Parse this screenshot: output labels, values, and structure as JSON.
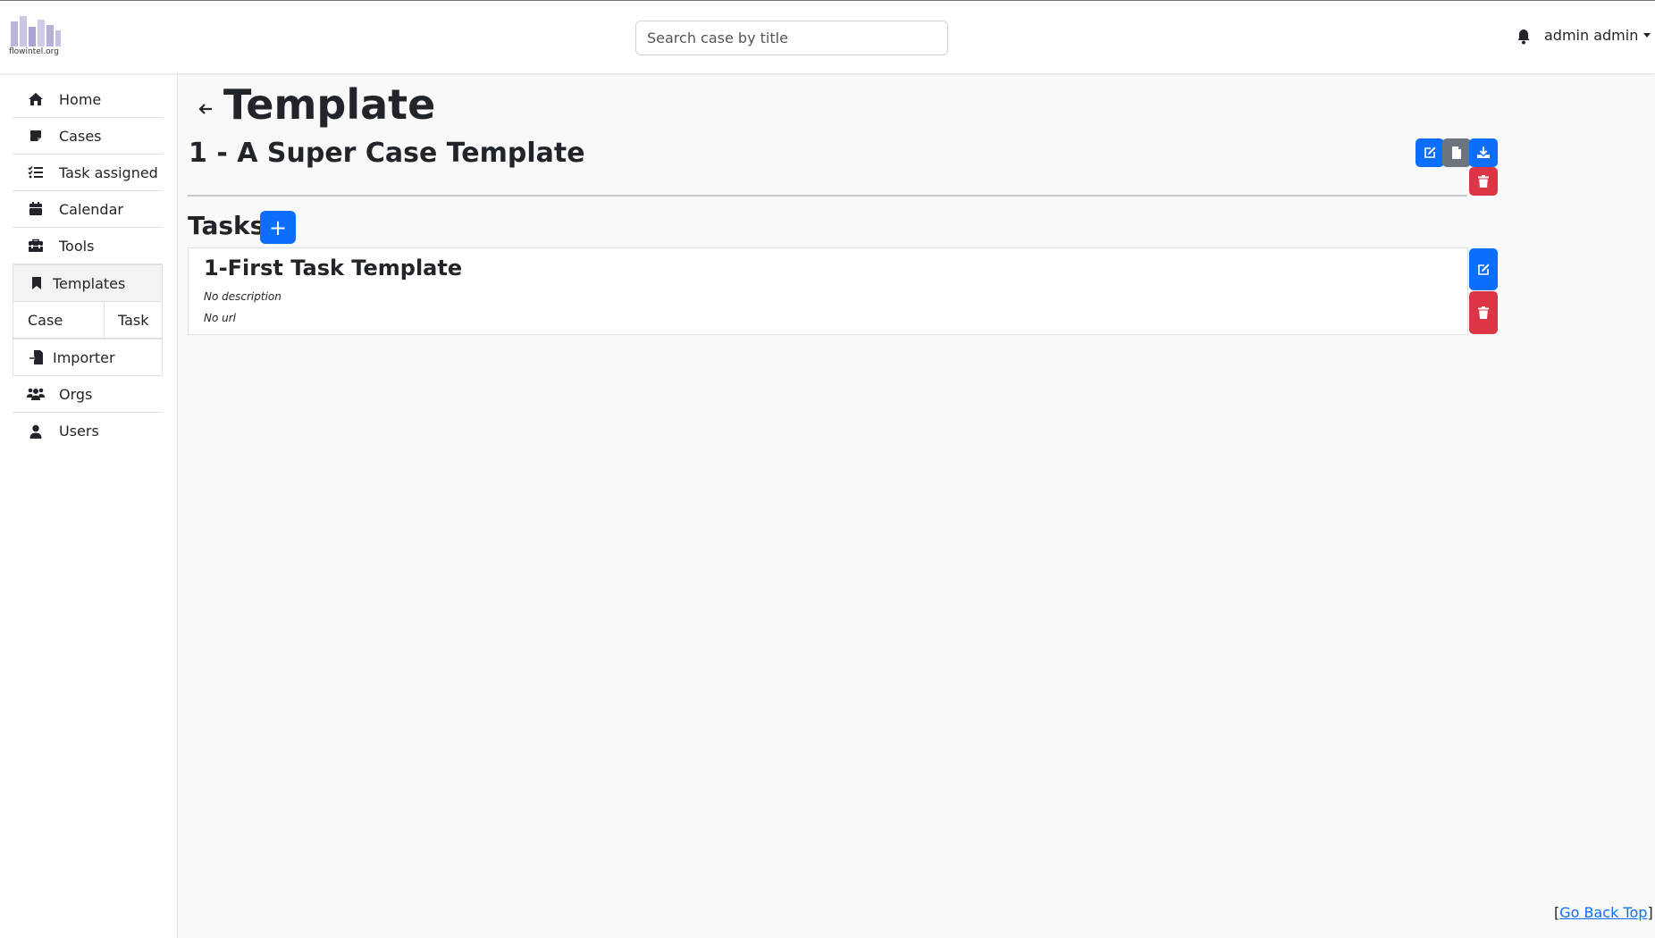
{
  "header": {
    "logo_text": "flowintel.org",
    "search_placeholder": "Search case by title",
    "search_value": "",
    "user_label": "admin admin"
  },
  "sidebar": {
    "items": [
      {
        "label": "Home",
        "icon": "home-icon"
      },
      {
        "label": "Cases",
        "icon": "sticky-note-icon"
      },
      {
        "label": "Task assigned",
        "icon": "list-check-icon"
      },
      {
        "label": "Calendar",
        "icon": "calendar-icon"
      },
      {
        "label": "Tools",
        "icon": "toolbox-icon"
      },
      {
        "label": "Templates",
        "icon": "bookmark-icon"
      },
      {
        "label": "Importer",
        "icon": "file-import-icon"
      },
      {
        "label": "Orgs",
        "icon": "users-icon"
      },
      {
        "label": "Users",
        "icon": "user-icon"
      }
    ],
    "template_subtabs": [
      "Case",
      "Task"
    ]
  },
  "main": {
    "page_title": "Template",
    "case_title": "1 - A Super Case Template",
    "tasks_title": "Tasks",
    "add_task_label": "+",
    "tasks": [
      {
        "title": "1-First Task Template",
        "description": "No description",
        "url": "No url"
      }
    ]
  },
  "footer": {
    "bracket_open": "[",
    "go_back_top": "Go Back Top",
    "bracket_close": "]"
  },
  "colors": {
    "primary": "#0d6efd",
    "secondary": "#6c757d",
    "danger": "#dc3545"
  }
}
